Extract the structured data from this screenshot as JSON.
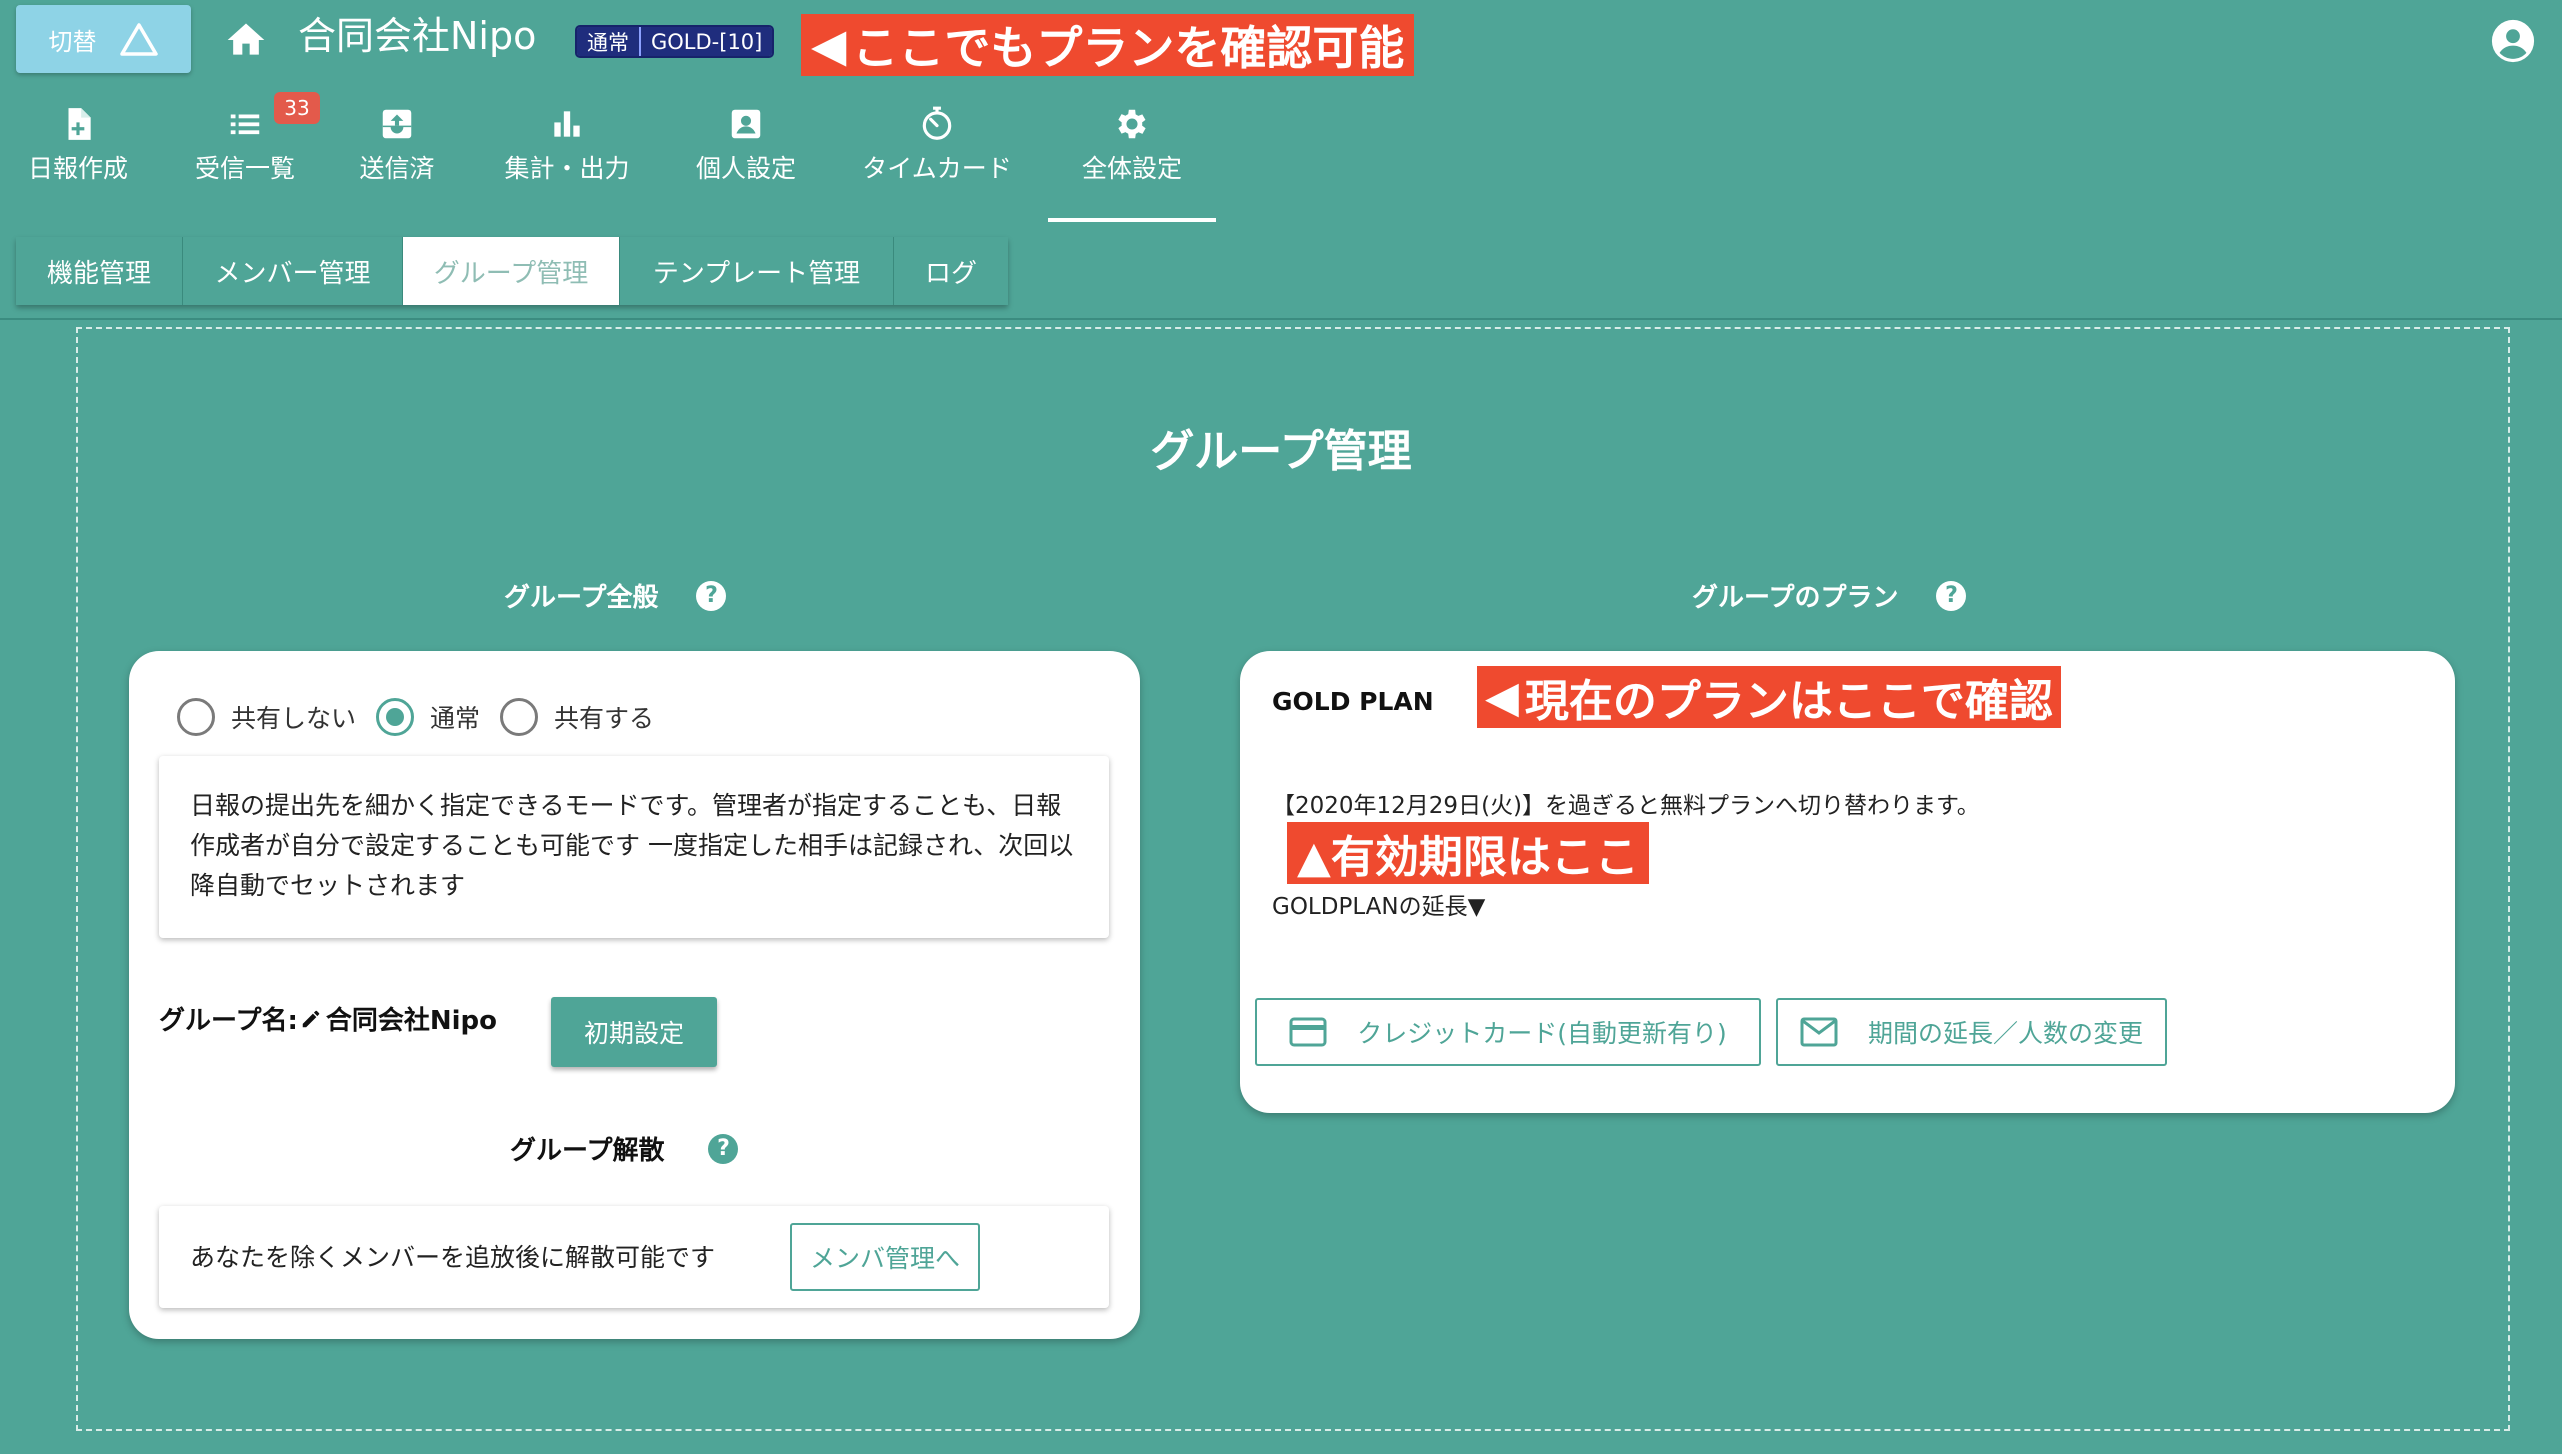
{
  "header": {
    "switch_label": "切替",
    "company_name": "合同会社Nipo",
    "plan_badge": {
      "mode": "通常",
      "plan": "GOLD-[10]"
    },
    "callout": "ここでもプランを確認可能"
  },
  "nav": {
    "items": [
      {
        "label": "日報作成",
        "icon": "file-plus-icon"
      },
      {
        "label": "受信一覧",
        "icon": "list-icon",
        "badge": "33"
      },
      {
        "label": "送信済",
        "icon": "inbox-upload-icon"
      },
      {
        "label": "集計・出力",
        "icon": "bar-chart-icon"
      },
      {
        "label": "個人設定",
        "icon": "person-box-icon"
      },
      {
        "label": "タイムカード",
        "icon": "timer-icon"
      },
      {
        "label": "全体設定",
        "icon": "gear-icon"
      }
    ],
    "active": "全体設定"
  },
  "subtabs": {
    "items": [
      "機能管理",
      "メンバー管理",
      "グループ管理",
      "テンプレート管理",
      "ログ"
    ],
    "active": "グループ管理"
  },
  "page": {
    "title": "グループ管理",
    "general": {
      "heading": "グループ全般",
      "help": "?",
      "radio_options": [
        "共有しない",
        "通常",
        "共有する"
      ],
      "selected_option": "通常",
      "mode_description": "日報の提出先を細かく指定できるモードです。管理者が指定することも、日報作成者が自分で設定することも可能です 一度指定した相手は記録され、次回以降自動でセットされます",
      "group_name_label": "グループ名:",
      "group_name_value": "合同会社Nipo",
      "init_button": "初期設定",
      "disband_heading": "グループ解散",
      "disband_text": "あなたを除くメンバーを追放後に解散可能です",
      "member_button": "メンバ管理へ"
    },
    "plan": {
      "heading": "グループのプラン",
      "help": "?",
      "plan_name": "GOLD PLAN",
      "callout_plan": "現在のプランはここで確認",
      "expiry_text": "【2020年12月29日(火)】を過ぎると無料プランへ切り替わります。",
      "callout_expiry": "▲有効期限はここ",
      "extend_link": "GOLDPLANの延長▼",
      "credit_button": "クレジットカード(自動更新有り)",
      "extend_button": "期間の延長／人数の変更"
    }
  },
  "colors": {
    "background": "#4fa597",
    "callout": "#ef4a2f",
    "badge": "#1f2d7d",
    "nav_badge": "#e35a4b"
  }
}
